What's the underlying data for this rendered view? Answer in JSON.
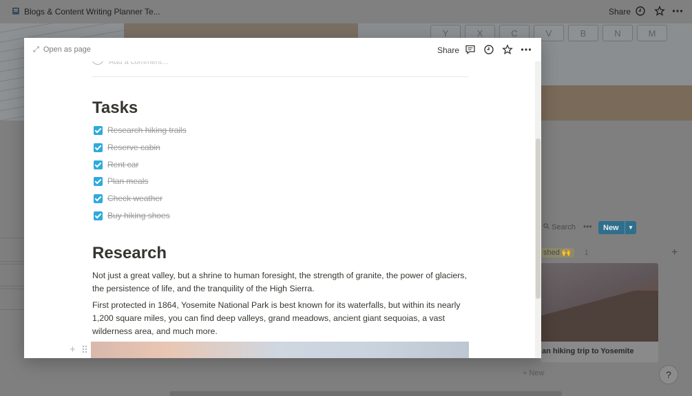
{
  "app": {
    "title": "Blogs & Content Writing Planner Te...",
    "share_label": "Share"
  },
  "cover": {
    "keys": [
      "Y",
      "X",
      "C",
      "V",
      "B",
      "N",
      "M"
    ]
  },
  "board": {
    "search_label": "Search",
    "more_label": "•••",
    "new_label": "New",
    "group_label": "shed 🙌",
    "group_count": "1",
    "card_title": "an hiking trip to Yosemite",
    "add_new_label": "+ New",
    "help_label": "?"
  },
  "modal": {
    "open_as_page": "Open as page",
    "share_label": "Share",
    "comment_placeholder": "Add a comment...",
    "tasks_heading": "Tasks",
    "tasks": [
      "Research hiking trails",
      "Reserve cabin",
      "Rent car",
      "Plan meals",
      "Check weather",
      "Buy hiking shoes"
    ],
    "research_heading": "Research",
    "paragraphs": [
      "Not just a great valley, but a shrine to human foresight, the strength of granite, the power of glaciers, the persistence of life, and the tranquility of the High Sierra.",
      "First protected in 1864, Yosemite National Park is best known for its waterfalls, but within its nearly 1,200 square miles, you can find deep valleys, grand meadows, ancient giant sequoias, a vast wilderness area, and much more."
    ]
  },
  "colors": {
    "checkbox": "#2eaadc",
    "new_button": "#2f6e8c",
    "overlay": "#808080"
  }
}
